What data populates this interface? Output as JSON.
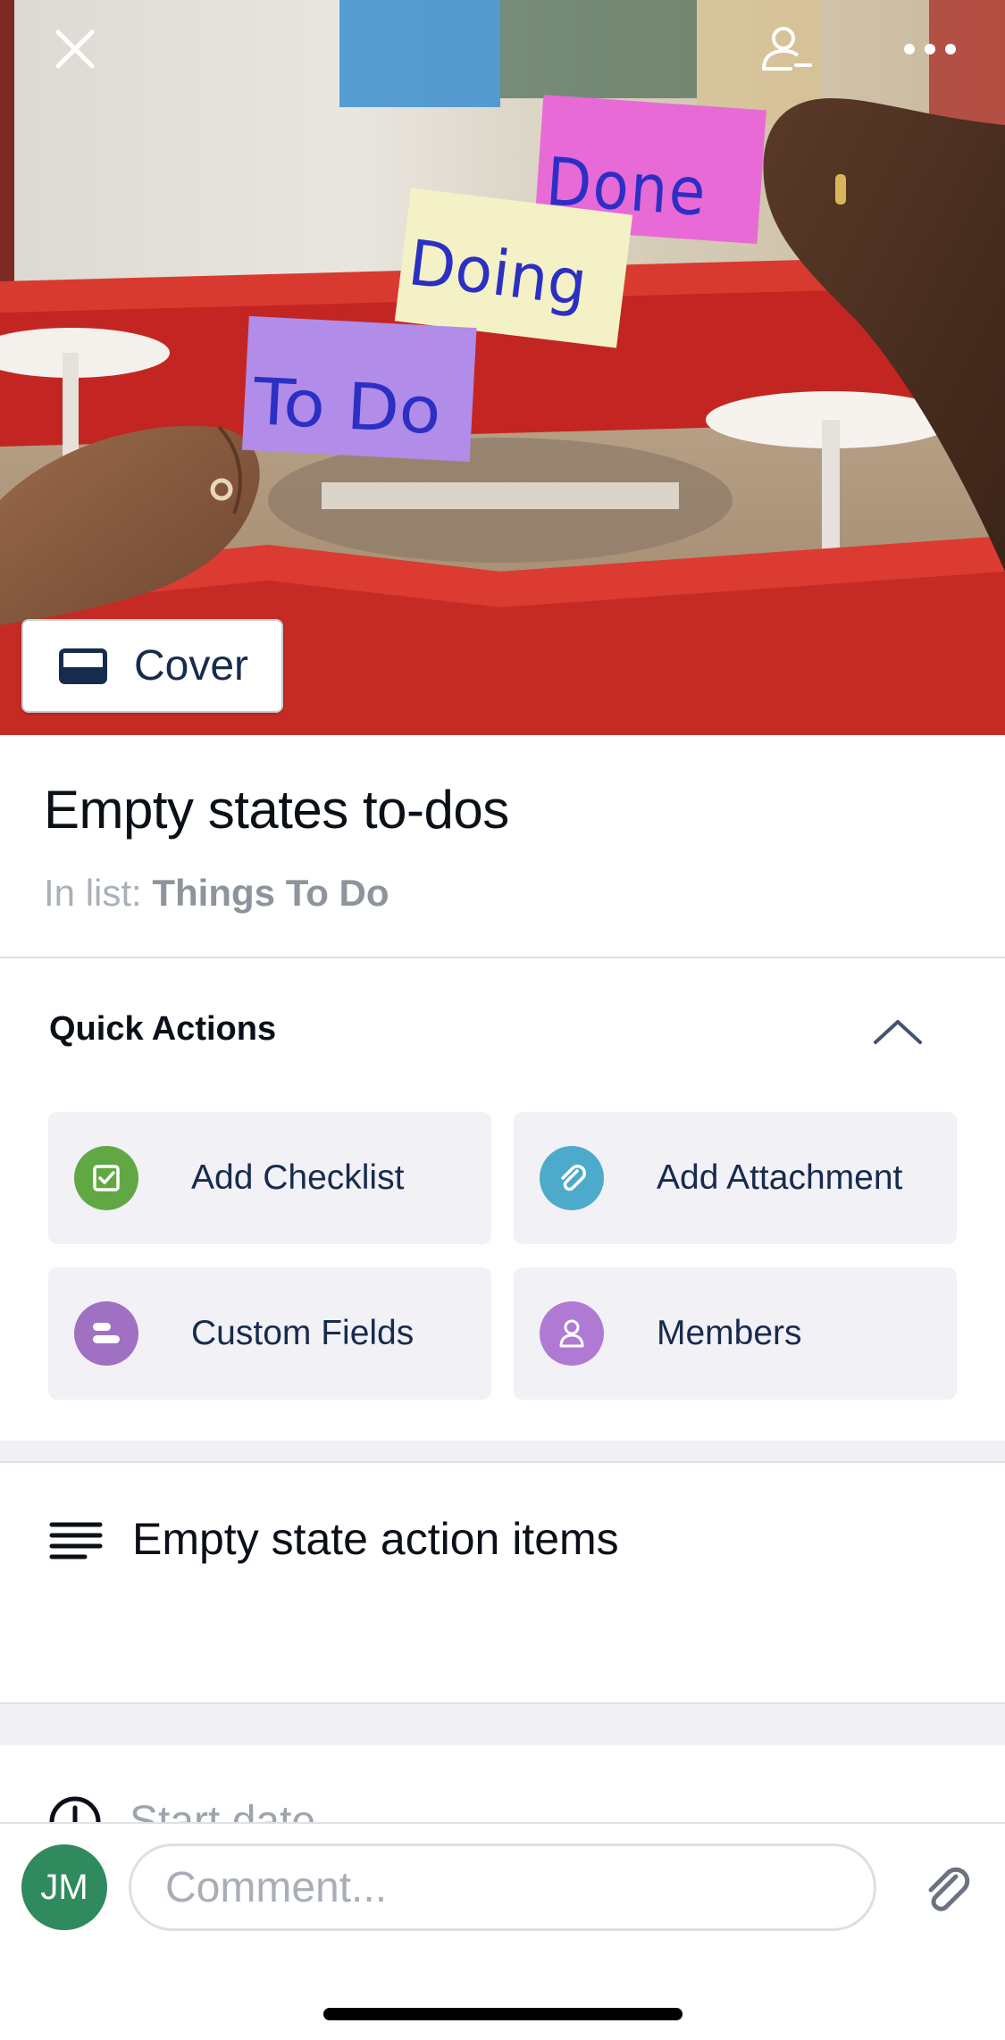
{
  "cover": {
    "button_label": "Cover",
    "notes": {
      "done": "Done",
      "doing": "Doing",
      "todo": "To Do"
    }
  },
  "header": {
    "close_icon": "close-icon",
    "leave_icon": "remove-member-icon",
    "more_icon": "more-horizontal-icon"
  },
  "card": {
    "title": "Empty states to-dos",
    "list_prefix": "In list:",
    "list_name": "Things To Do"
  },
  "quick_actions": {
    "title": "Quick Actions",
    "items": [
      {
        "label": "Add Checklist",
        "icon": "checklist-icon",
        "color": "#61a844"
      },
      {
        "label": "Add Attachment",
        "icon": "paperclip-icon",
        "color": "#4eaacb"
      },
      {
        "label": "Custom Fields",
        "icon": "custom-fields-icon",
        "color": "#a070c2"
      },
      {
        "label": "Members",
        "icon": "member-icon",
        "color": "#b07ad4"
      }
    ]
  },
  "description": {
    "text": "Empty state action items"
  },
  "dates": {
    "start_label": "Start date"
  },
  "comment": {
    "placeholder": "Comment...",
    "avatar_initials": "JM"
  },
  "colors": {
    "avatar": "#2f8a5e",
    "sofa_red": "#c32622",
    "note_pink": "#e86ad6",
    "note_yellow": "#f4f1c6",
    "note_purple": "#b18ce8",
    "marker_blue": "#2c2fc4"
  }
}
